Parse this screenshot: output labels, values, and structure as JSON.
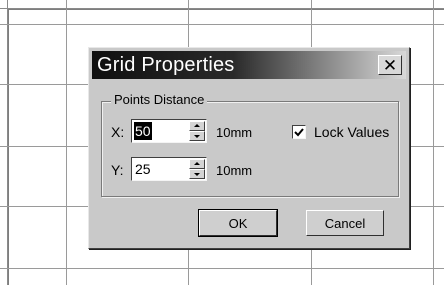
{
  "dialog": {
    "title": "Grid Properties",
    "close_glyph": "✕",
    "close_icon": "close-icon",
    "group_label": "Points Distance",
    "x": {
      "label": "X:",
      "value": "50",
      "unit": "10mm"
    },
    "y": {
      "label": "Y:",
      "value": "25",
      "unit": "10mm"
    },
    "lock_values": {
      "label": "Lock Values",
      "checked": true
    },
    "ok_label": "OK",
    "cancel_label": "Cancel"
  }
}
